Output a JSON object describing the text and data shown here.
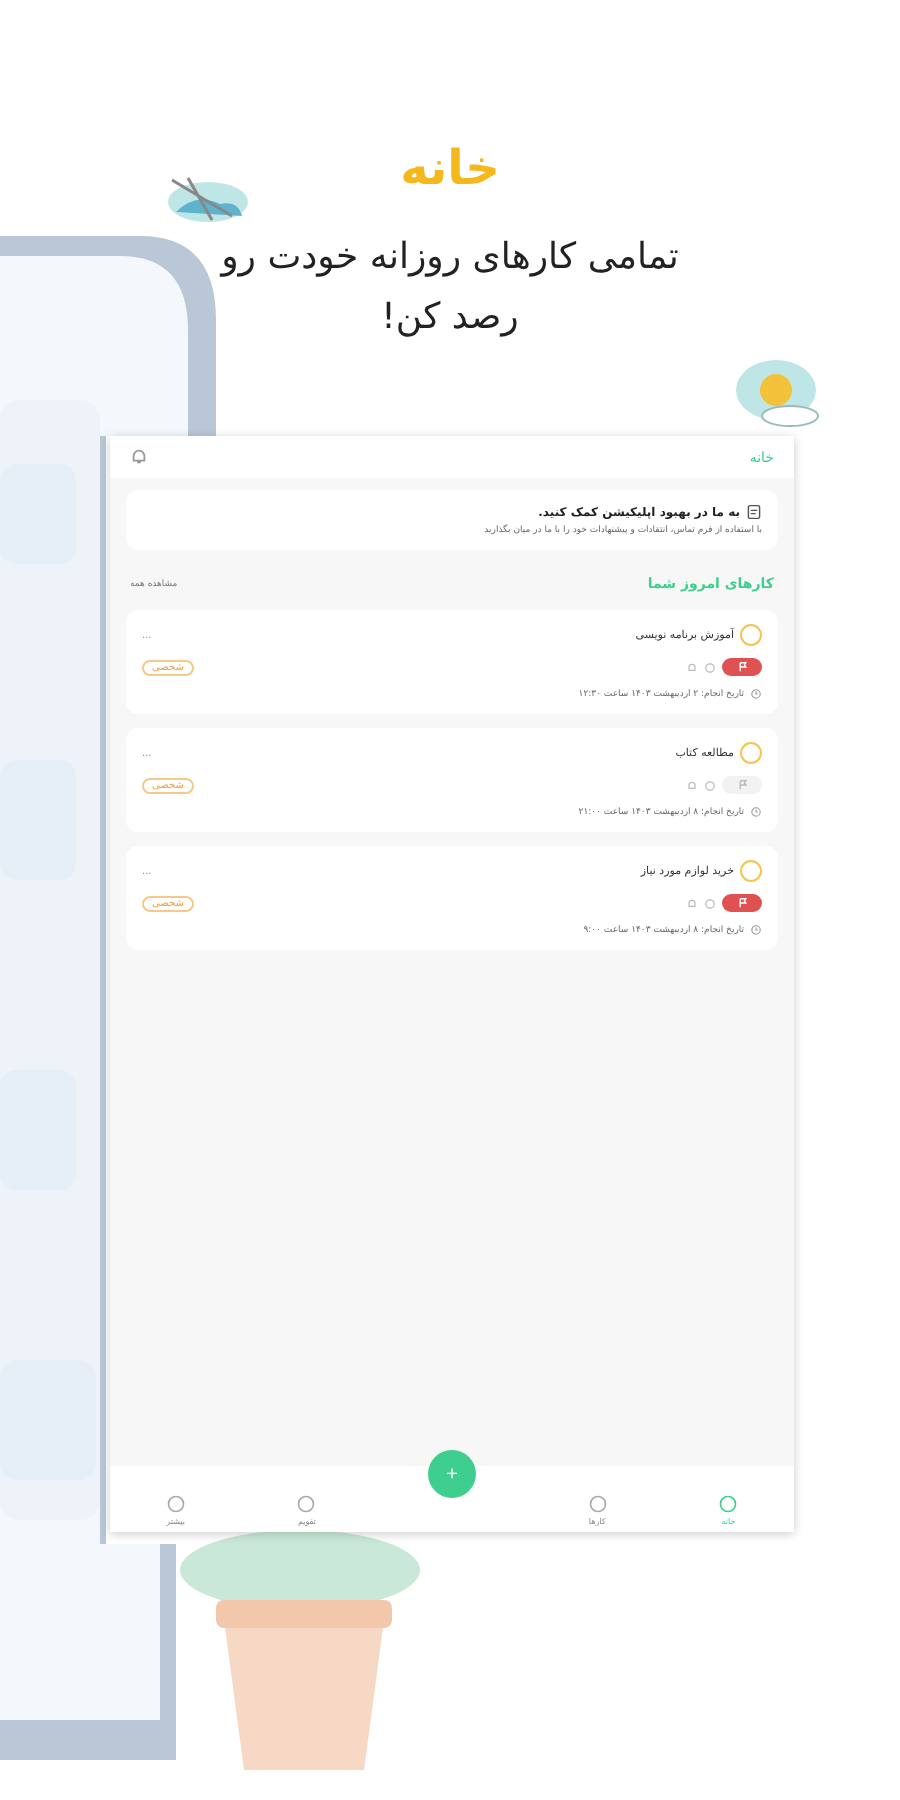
{
  "promo": {
    "title": "خانه",
    "subtitle": "تمامی کارهای روزانه خودت رو رصد کن!"
  },
  "app_bar": {
    "title": "خانه"
  },
  "banner": {
    "title": "به ما در بهبود اپلیکیشن کمک کنید.",
    "text": "با استفاده از فرم تماس، انتقادات و پیشنهادات خود را با ما در میان بگذارید"
  },
  "section": {
    "title": "کارهای امروز شما",
    "link": "مشاهده همه"
  },
  "tasks": [
    {
      "title": "آموزش برنامه نویسی",
      "checked": false,
      "flagged": true,
      "category": "شخصی",
      "date": "تاریخ انجام: ۲ اردیبهشت ۱۴۰۳ ساعت ۱۲:۳۰",
      "menu": "..."
    },
    {
      "title": "مطالعه کتاب",
      "checked": false,
      "flagged": false,
      "category": "شخصی",
      "date": "تاریخ انجام: ۸ اردیبهشت ۱۴۰۳ ساعت ۲۱:۰۰",
      "menu": "..."
    },
    {
      "title": "خرید لوازم مورد نیاز",
      "checked": false,
      "flagged": true,
      "category": "شخصی",
      "date": "تاریخ انجام: ۸ اردیبهشت ۱۴۰۳ ساعت ۹:۰۰",
      "menu": "..."
    }
  ],
  "fab": {
    "label": "+"
  },
  "nav": [
    {
      "label": "خانه",
      "selected": true
    },
    {
      "label": "کارها",
      "selected": false
    },
    {
      "label": "تقویم",
      "selected": false
    },
    {
      "label": "بیشتر",
      "selected": false
    }
  ]
}
